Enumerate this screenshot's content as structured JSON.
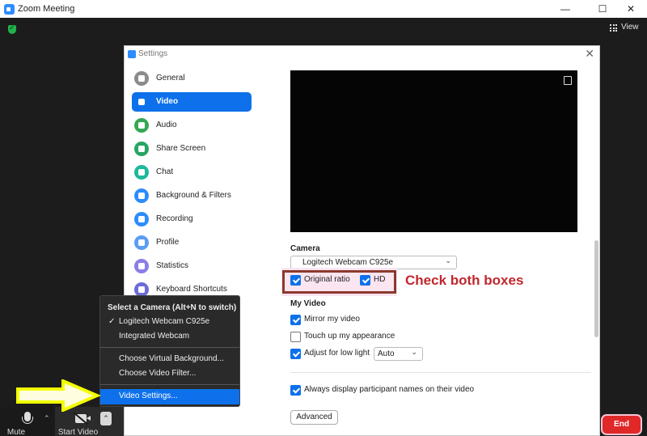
{
  "window": {
    "title": "Zoom Meeting",
    "minimize": "—",
    "maximize": "☐",
    "close": "✕"
  },
  "meeting": {
    "view_label": "View"
  },
  "settings": {
    "title": "Settings",
    "close": "✕",
    "nav": [
      {
        "label": "General",
        "color": "#8c8c8c"
      },
      {
        "label": "Video",
        "color": "#0e71eb",
        "active": true
      },
      {
        "label": "Audio",
        "color": "#35a853"
      },
      {
        "label": "Share Screen",
        "color": "#27a561"
      },
      {
        "label": "Chat",
        "color": "#1eb89a"
      },
      {
        "label": "Background & Filters",
        "color": "#2d8cff"
      },
      {
        "label": "Recording",
        "color": "#2d8cff"
      },
      {
        "label": "Profile",
        "color": "#5b9cf5"
      },
      {
        "label": "Statistics",
        "color": "#8a7ee8"
      },
      {
        "label": "Keyboard Shortcuts",
        "color": "#6c6cd8"
      }
    ],
    "camera_label": "Camera",
    "camera_value": "Logitech Webcam C925e",
    "original_ratio": "Original ratio",
    "hd": "HD",
    "annotation": "Check both boxes",
    "my_video_label": "My Video",
    "mirror": "Mirror my video",
    "touch_up": "Touch up my appearance",
    "low_light": "Adjust for low light",
    "low_light_value": "Auto",
    "always_display": "Always display participant names on their video",
    "advanced": "Advanced"
  },
  "toolbar": {
    "mute": "Mute",
    "start_video": "Start Video",
    "end": "End"
  },
  "camera_menu": {
    "header": "Select a Camera (Alt+N to switch)",
    "check": "✓",
    "cam1": "Logitech Webcam C925e",
    "cam2": "Integrated Webcam",
    "virtual_bg": "Choose Virtual Background...",
    "video_filter": "Choose Video Filter...",
    "video_settings": "Video Settings..."
  },
  "colors": {
    "accent": "#0e71eb",
    "annotation": "#c0272d",
    "end": "#e02828",
    "arrow": "#f2ff00"
  }
}
